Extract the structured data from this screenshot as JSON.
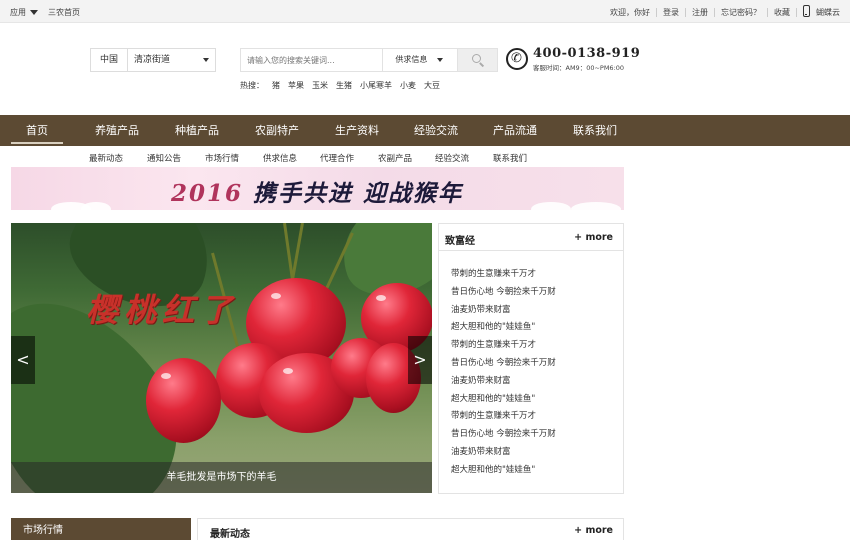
{
  "topbar": {
    "app_label": "应用",
    "home_link": "三农首页",
    "welcome": "欢迎，你好",
    "login": "登录",
    "register": "注册",
    "forgot": "忘记密码？",
    "favorite": "收藏",
    "mobile": "蝴蝶云"
  },
  "header": {
    "region_country": "中国",
    "region_select": "清凉街道",
    "search_placeholder": "请输入您的搜索关键词...",
    "search_category": "供求信息",
    "hot_label": "热搜：",
    "hot_words": [
      "猪",
      "苹果",
      "玉米",
      "生猪",
      "小尾寒羊",
      "小麦",
      "大豆"
    ],
    "phone": "400-0138-919",
    "service_time": "客服时间：AM9：00~PM6:00"
  },
  "nav": {
    "items": [
      "首页",
      "养殖产品",
      "种植产品",
      "农副特产",
      "生产资料",
      "经验交流",
      "产品流通",
      "联系我们"
    ]
  },
  "subnav": {
    "items": [
      "最新动态",
      "通知公告",
      "市场行情",
      "供求信息",
      "代理合作",
      "农副产品",
      "经验交流",
      "联系我们"
    ]
  },
  "banner": {
    "year": "2016",
    "slogan": "携手共进 迎战猴年"
  },
  "slider": {
    "title": "樱桃红了",
    "caption": "羊毛批发是市场下的羊毛",
    "prev": "<",
    "next": ">"
  },
  "fortune": {
    "title": "致富经",
    "more": "+ more",
    "items": [
      "带刺的生意赚来千万才",
      "昔日伤心地 今朝捡来千万财",
      "油麦奶带来财富",
      "超大胆和他的\"娃娃鱼\"",
      "带刺的生意赚来千万才",
      "昔日伤心地 今朝捡来千万财",
      "油麦奶带来财富",
      "超大胆和他的\"娃娃鱼\"",
      "带刺的生意赚来千万才",
      "昔日伤心地 今朝捡来千万财",
      "油麦奶带来财富",
      "超大胆和他的\"娃娃鱼\""
    ]
  },
  "bottom": {
    "market_title": "市场行情",
    "news_title": "最新动态",
    "news_more": "+ more"
  },
  "colors": {
    "nav_brown": "#5c4a33",
    "cherry_red": "#e02638"
  }
}
